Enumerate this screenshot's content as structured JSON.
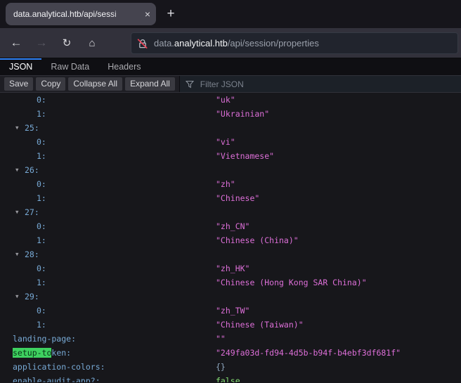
{
  "window": {
    "tab": {
      "title": "data.analytical.htb/api/sessi",
      "close_icon": "×"
    },
    "new_tab_icon": "+"
  },
  "navbar": {
    "back_icon": "←",
    "forward_icon": "→",
    "reload_icon": "↻",
    "home_icon": "⌂",
    "url": {
      "prefix": "data.",
      "host": "analytical.htb",
      "path": "/api/session/properties"
    }
  },
  "viewer": {
    "tabs": [
      {
        "label": "JSON",
        "active": true
      },
      {
        "label": "Raw Data",
        "active": false
      },
      {
        "label": "Headers",
        "active": false
      }
    ],
    "toolbar": {
      "buttons": [
        "Save",
        "Copy",
        "Collapse All",
        "Expand All"
      ],
      "filter_placeholder": "Filter JSON"
    }
  },
  "json_rows": [
    {
      "key": "0:",
      "level": 2,
      "type": "string",
      "value": "uk"
    },
    {
      "key": "1:",
      "level": 2,
      "type": "string",
      "value": "Ukrainian"
    },
    {
      "key": "25:",
      "level": 1,
      "twisty": true
    },
    {
      "key": "0:",
      "level": 2,
      "type": "string",
      "value": "vi"
    },
    {
      "key": "1:",
      "level": 2,
      "type": "string",
      "value": "Vietnamese"
    },
    {
      "key": "26:",
      "level": 1,
      "twisty": true
    },
    {
      "key": "0:",
      "level": 2,
      "type": "string",
      "value": "zh"
    },
    {
      "key": "1:",
      "level": 2,
      "type": "string",
      "value": "Chinese"
    },
    {
      "key": "27:",
      "level": 1,
      "twisty": true
    },
    {
      "key": "0:",
      "level": 2,
      "type": "string",
      "value": "zh_CN"
    },
    {
      "key": "1:",
      "level": 2,
      "type": "string",
      "value": "Chinese (China)"
    },
    {
      "key": "28:",
      "level": 1,
      "twisty": true
    },
    {
      "key": "0:",
      "level": 2,
      "type": "string",
      "value": "zh_HK"
    },
    {
      "key": "1:",
      "level": 2,
      "type": "string",
      "value": "Chinese (Hong Kong SAR China)"
    },
    {
      "key": "29:",
      "level": 1,
      "twisty": true
    },
    {
      "key": "0:",
      "level": 2,
      "type": "string",
      "value": "zh_TW"
    },
    {
      "key": "1:",
      "level": 2,
      "type": "string",
      "value": "Chinese (Taiwan)"
    },
    {
      "key": "landing-page:",
      "level": 0,
      "type": "string",
      "value": ""
    },
    {
      "key": "setup-token:",
      "level": 0,
      "type": "string",
      "value": "249fa03d-fd94-4d5b-b94f-b4ebf3df681f",
      "highlight": "setup-to"
    },
    {
      "key": "application-colors:",
      "level": 0,
      "type": "object",
      "value": "{}"
    },
    {
      "key": "enable-audit-app?:",
      "level": 0,
      "type": "boolean",
      "value": "false"
    }
  ],
  "colors": {
    "accent_blue": "#2f82f7",
    "key": "#78aad6",
    "string": "#dd6fd8",
    "boolean": "#86de74",
    "find_highlight_bg": "#3ed160",
    "insecure_slash": "#ef4056"
  }
}
